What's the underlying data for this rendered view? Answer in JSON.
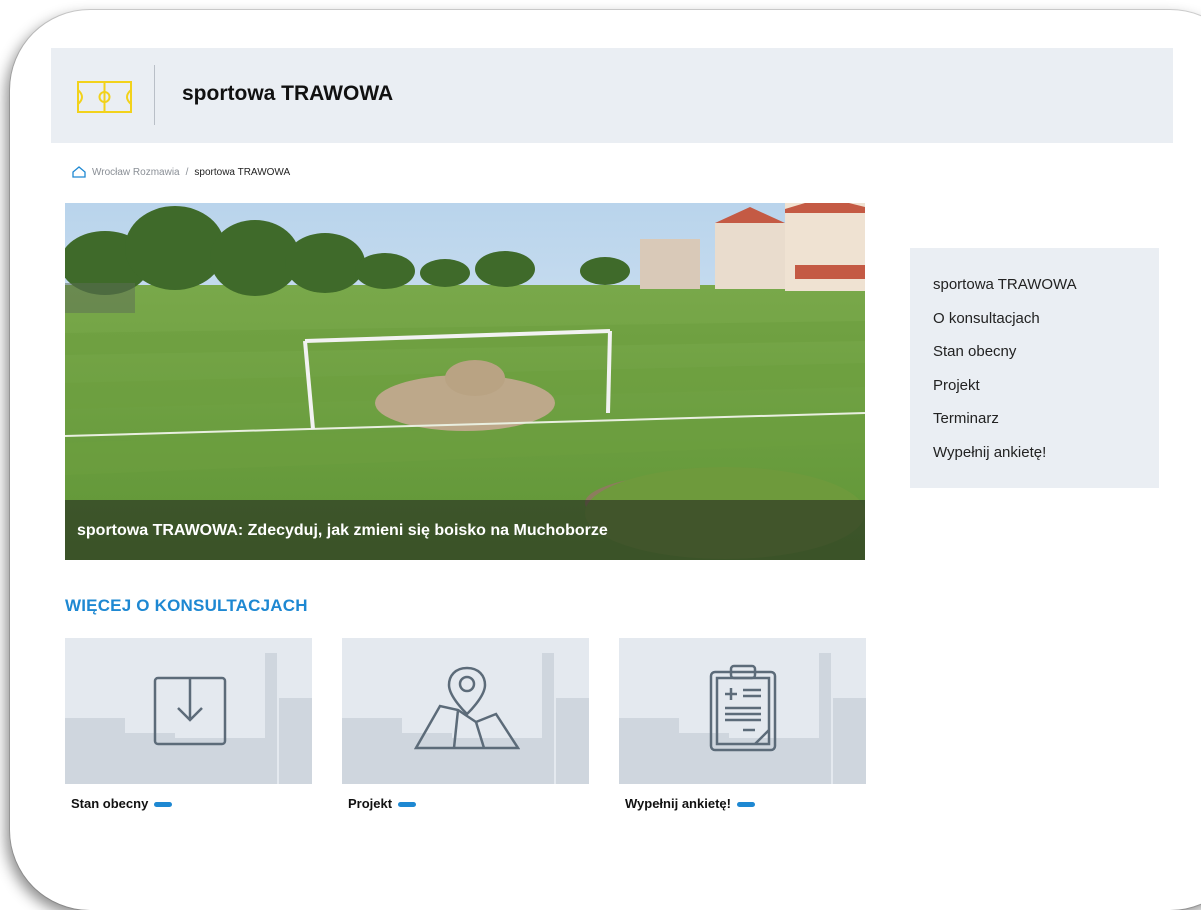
{
  "header": {
    "site_title": "sportowa TRAWOWA"
  },
  "breadcrumb": {
    "home": "Wrocław Rozmawia",
    "separator": "/",
    "current": "sportowa TRAWOWA"
  },
  "hero": {
    "caption": "sportowa TRAWOWA: Zdecyduj, jak zmieni się boisko na Muchoborze"
  },
  "sidebar": {
    "items": [
      {
        "label": "sportowa TRAWOWA"
      },
      {
        "label": "O konsultacjach"
      },
      {
        "label": "Stan obecny"
      },
      {
        "label": "Projekt"
      },
      {
        "label": "Terminarz"
      },
      {
        "label": "Wypełnij ankietę!"
      }
    ]
  },
  "more": {
    "title": "WIĘCEJ O KONSULTACJACH",
    "cards": [
      {
        "label": "Stan obecny",
        "icon": "download-box-icon"
      },
      {
        "label": "Projekt",
        "icon": "map-pin-icon"
      },
      {
        "label": "Wypełnij ankietę!",
        "icon": "clipboard-icon"
      }
    ]
  },
  "colors": {
    "accent": "#1e88d2",
    "logo": "#f2d21b",
    "panel": "#eaeef3"
  }
}
